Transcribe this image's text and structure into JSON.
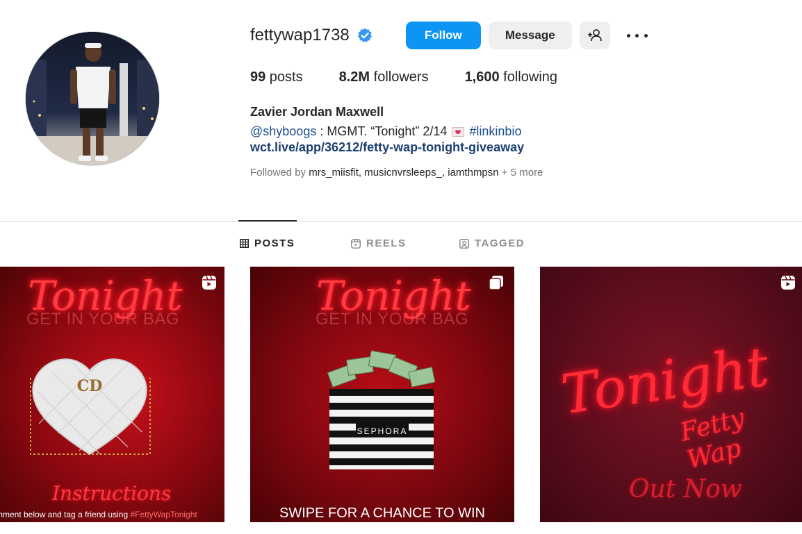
{
  "profile": {
    "username": "fettywap1738",
    "verified": true,
    "follow_label": "Follow",
    "message_label": "Message",
    "stats": {
      "posts_count": "99",
      "posts_label": " posts",
      "followers_count": "8.2M",
      "followers_label": " followers",
      "following_count": "1,600",
      "following_label": " following"
    },
    "full_name": "Zavier Jordan Maxwell",
    "bio": {
      "mention": "@shyboogs",
      "text": " : MGMT. “Tonight” 2/14 ",
      "hashtag": "#linkinbio"
    },
    "website": "wct.live/app/36212/fetty-wap-tonight-giveaway",
    "followed_by": {
      "prefix": "Followed by ",
      "names": "mrs_miisfit, musicnvrsleeps_, iamthmpsn",
      "more": " + 5 more"
    }
  },
  "tabs": {
    "posts": "POSTS",
    "reels": "REELS",
    "tagged": "TAGGED",
    "active": "posts"
  },
  "posts": [
    {
      "title": "Tonight",
      "subtitle": "GET IN YOUR BAG",
      "heading": "Instructions",
      "caption_start": "mment below and tag a friend using ",
      "caption_tag": "#FettyWapTonight",
      "type_icon": "reel-icon"
    },
    {
      "title": "Tonight",
      "subtitle": "GET IN YOUR BAG",
      "bag_brand": "SEPHORA",
      "footer": "SWIPE FOR A CHANCE TO WIN",
      "type_icon": "carousel-icon"
    },
    {
      "title": "Tonight",
      "signature": "Fetty Wap",
      "footer": "Out Now",
      "type_icon": "reel-icon"
    }
  ],
  "colors": {
    "follow_button": "#0d95f6",
    "verified_badge": "#3897f0",
    "neon_red": "#ff3a40"
  }
}
